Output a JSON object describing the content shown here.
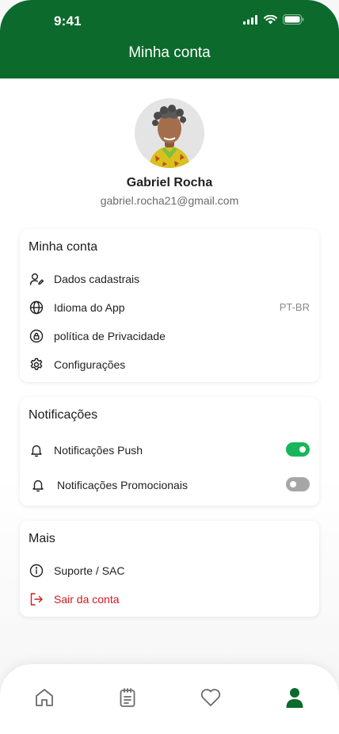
{
  "status_bar": {
    "time": "9:41"
  },
  "header": {
    "title": "Minha conta"
  },
  "profile": {
    "name": "Gabriel Rocha",
    "email": "gabriel.rocha21@gmail.com"
  },
  "account_section": {
    "title": "Minha conta",
    "items": [
      {
        "label": "Dados cadastrais",
        "icon": "user-edit-icon"
      },
      {
        "label": "Idioma do App",
        "icon": "globe-icon",
        "value": "PT-BR"
      },
      {
        "label": "política de Privacidade",
        "icon": "privacy-lock-icon"
      },
      {
        "label": "Configurações",
        "icon": "gear-icon"
      }
    ]
  },
  "notifications_section": {
    "title": "Notificações",
    "items": [
      {
        "label": "Notificações Push",
        "icon": "bell-icon",
        "enabled": true
      },
      {
        "label": "Notificações Promocionais",
        "icon": "bell-icon",
        "enabled": false
      }
    ]
  },
  "more_section": {
    "title": "Mais",
    "items": [
      {
        "label": "Suporte / SAC",
        "icon": "info-icon"
      },
      {
        "label": "Sair da conta",
        "icon": "logout-icon"
      }
    ]
  },
  "tabbar": {
    "items": [
      {
        "icon": "home-icon",
        "active": false
      },
      {
        "icon": "orders-notepad-icon",
        "active": false
      },
      {
        "icon": "heart-icon",
        "active": false
      },
      {
        "icon": "profile-icon",
        "active": true
      }
    ]
  },
  "colors": {
    "brand_green": "#0b6a2c",
    "toggle_on": "#18b55a",
    "toggle_off": "#a6a6a6",
    "danger": "#d2191e",
    "tab_inactive": "#6b6b6b"
  }
}
